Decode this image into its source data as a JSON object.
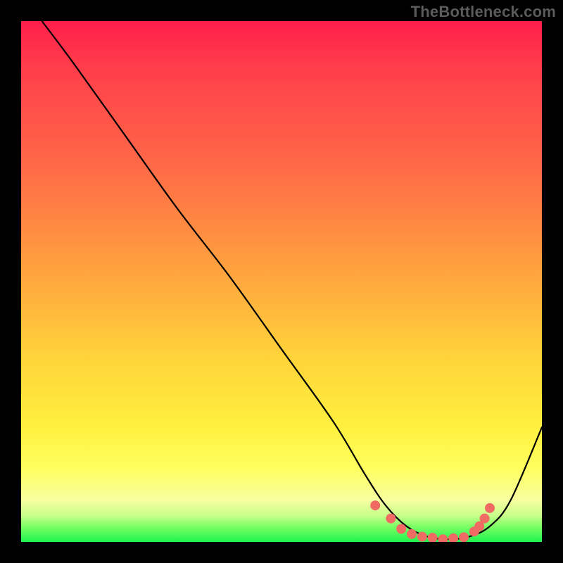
{
  "watermark": "TheBottleneck.com",
  "colors": {
    "coral_dot": "#ef6b64",
    "curve": "#000000"
  },
  "chart_data": {
    "type": "line",
    "title": "",
    "xlabel": "",
    "ylabel": "",
    "xlim": [
      0,
      100
    ],
    "ylim": [
      0,
      100
    ],
    "series": [
      {
        "name": "bottleneck-curve",
        "x": [
          4,
          10,
          20,
          30,
          40,
          50,
          60,
          66,
          70,
          74,
          78,
          82,
          86,
          90,
          94,
          100
        ],
        "y": [
          100,
          92,
          78,
          64,
          51,
          37,
          23,
          13,
          7,
          3,
          1,
          0.5,
          1,
          3,
          8,
          22
        ]
      }
    ],
    "highlight_dots": {
      "name": "optimal-range",
      "x": [
        68,
        71,
        73,
        75,
        77,
        79,
        81,
        83,
        85,
        87,
        88,
        89,
        90
      ],
      "y": [
        7,
        4.5,
        2.5,
        1.5,
        1,
        0.8,
        0.5,
        0.7,
        0.9,
        2,
        3,
        4.5,
        6.5
      ]
    }
  }
}
